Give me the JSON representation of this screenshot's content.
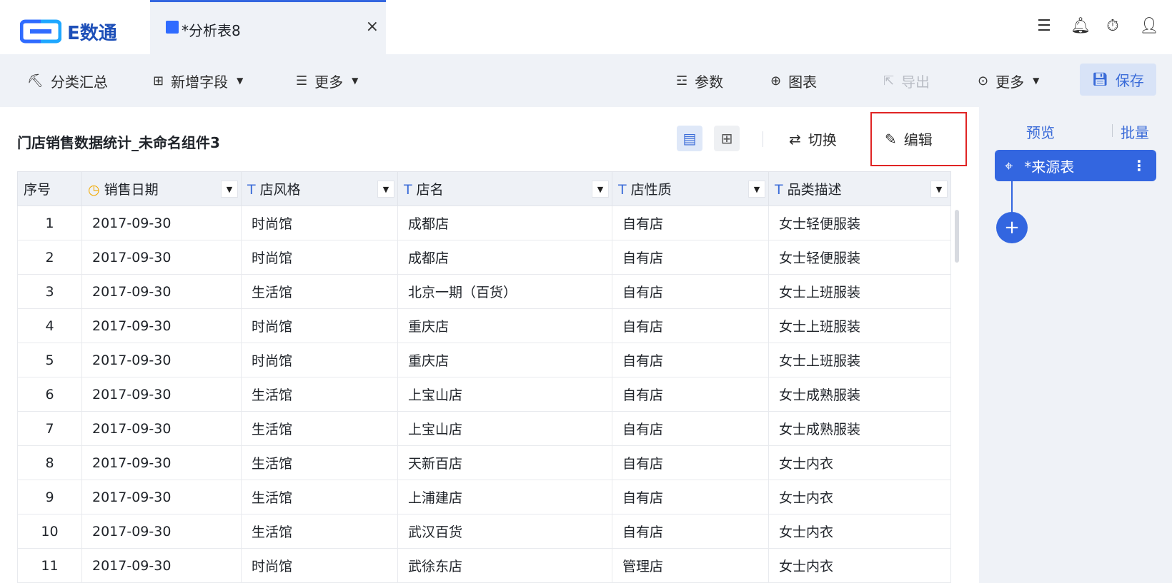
{
  "app": {
    "logo_text": "E数通"
  },
  "tab": {
    "title": "*分析表8",
    "close": "×"
  },
  "toolbar": {
    "classify": "分类汇总",
    "add_field": "新增字段",
    "more_left": "更多",
    "params": "参数",
    "chart": "图表",
    "export": "导出",
    "more_right": "更多",
    "save": "保存"
  },
  "component": {
    "title": "门店销售数据统计_未命名组件3",
    "switch": "切换",
    "edit": "编辑"
  },
  "table": {
    "headers": [
      "序号",
      "销售日期",
      "店风格",
      "店名",
      "店性质",
      "品类描述"
    ],
    "rows": [
      [
        "1",
        "2017-09-30",
        "时尚馆",
        "成都店",
        "自有店",
        "女士轻便服装"
      ],
      [
        "2",
        "2017-09-30",
        "时尚馆",
        "成都店",
        "自有店",
        "女士轻便服装"
      ],
      [
        "3",
        "2017-09-30",
        "生活馆",
        "北京一期（百货）",
        "自有店",
        "女士上班服装"
      ],
      [
        "4",
        "2017-09-30",
        "时尚馆",
        "重庆店",
        "自有店",
        "女士上班服装"
      ],
      [
        "5",
        "2017-09-30",
        "时尚馆",
        "重庆店",
        "自有店",
        "女士上班服装"
      ],
      [
        "6",
        "2017-09-30",
        "生活馆",
        "上宝山店",
        "自有店",
        "女士成熟服装"
      ],
      [
        "7",
        "2017-09-30",
        "生活馆",
        "上宝山店",
        "自有店",
        "女士成熟服装"
      ],
      [
        "8",
        "2017-09-30",
        "生活馆",
        "天新百店",
        "自有店",
        "女士内衣"
      ],
      [
        "9",
        "2017-09-30",
        "生活馆",
        "上浦建店",
        "自有店",
        "女士内衣"
      ],
      [
        "10",
        "2017-09-30",
        "生活馆",
        "武汉百货",
        "自有店",
        "女士内衣"
      ],
      [
        "11",
        "2017-09-30",
        "时尚馆",
        "武徐东店",
        "管理店",
        "女士内衣"
      ]
    ]
  },
  "side": {
    "preview": "预览",
    "batch": "批量",
    "source_node": "*来源表"
  },
  "colors": {
    "accent": "#3366e0",
    "highlight_border": "#e02424"
  }
}
